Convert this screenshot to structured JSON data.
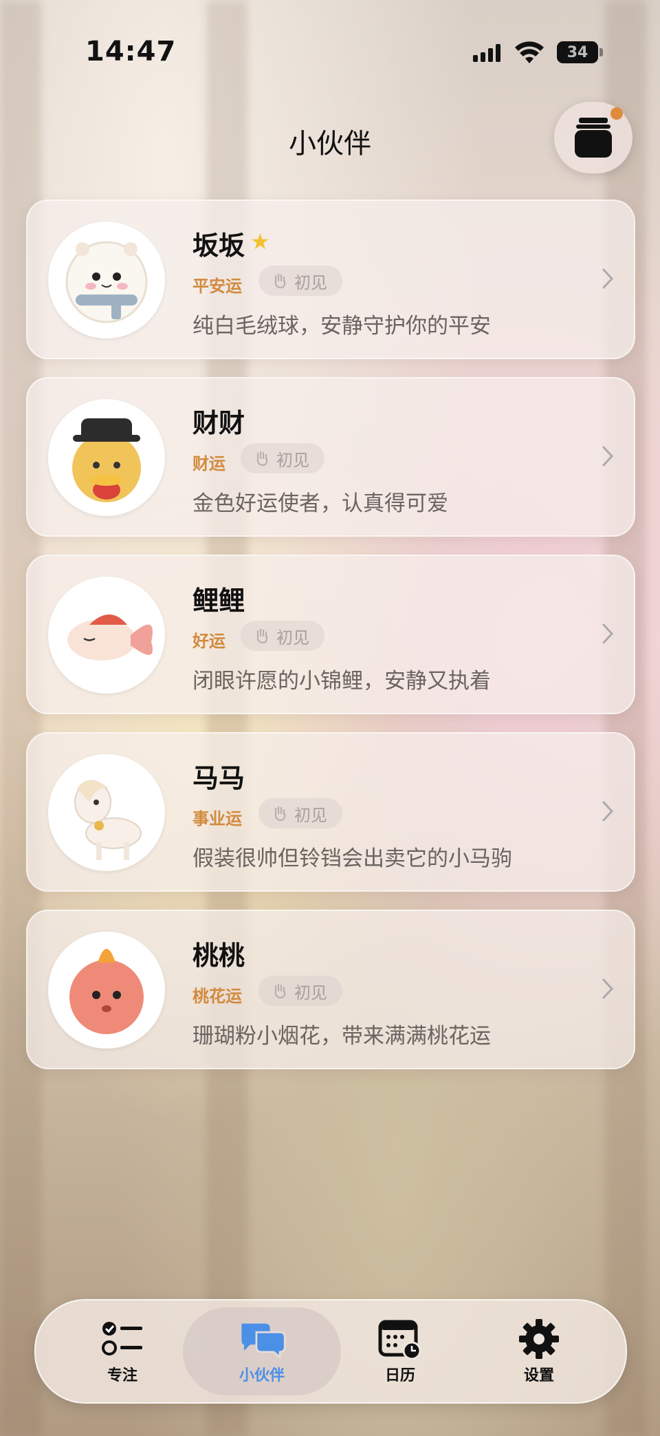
{
  "status_bar": {
    "time": "14:47",
    "battery": "34"
  },
  "header": {
    "title": "小伙伴",
    "jar_icon": "jar-icon"
  },
  "companions": [
    {
      "name": "坂坂",
      "starred": true,
      "luck": "平安运",
      "stage": "初见",
      "description": "纯白毛绒球，安静守护你的平安",
      "avatar": "white-fluffy-hamster"
    },
    {
      "name": "财财",
      "starred": false,
      "luck": "财运",
      "stage": "初见",
      "description": "金色好运使者，认真得可爱",
      "avatar": "golden-fortune-chick"
    },
    {
      "name": "鲤鲤",
      "starred": false,
      "luck": "好运",
      "stage": "初见",
      "description": "闭眼许愿的小锦鲤，安静又执着",
      "avatar": "koi-fish"
    },
    {
      "name": "马马",
      "starred": false,
      "luck": "事业运",
      "stage": "初见",
      "description": "假装很帅但铃铛会出卖它的小马驹",
      "avatar": "pony"
    },
    {
      "name": "桃桃",
      "starred": false,
      "luck": "桃花运",
      "stage": "初见",
      "description": "珊瑚粉小烟花，带来满满桃花运",
      "avatar": "pink-fluff-firework"
    }
  ],
  "tabs": [
    {
      "label": "专注",
      "icon": "checklist-icon",
      "active": false
    },
    {
      "label": "小伙伴",
      "icon": "chat-bubbles-icon",
      "active": true
    },
    {
      "label": "日历",
      "icon": "calendar-clock-icon",
      "active": false
    },
    {
      "label": "设置",
      "icon": "gear-icon",
      "active": false
    }
  ],
  "colors": {
    "accent": "#4c8fe6",
    "luck_text": "#d28a3e",
    "star": "#f2c230",
    "notification_dot": "#e08a3c"
  }
}
